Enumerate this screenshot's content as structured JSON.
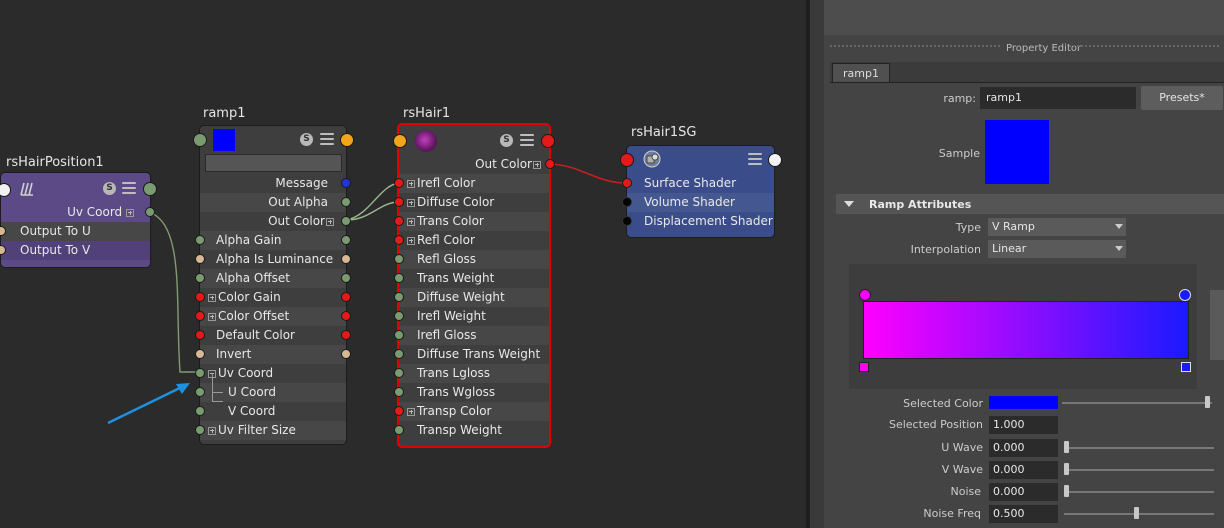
{
  "graph": {
    "rsHairPosition1": {
      "title": "rsHairPosition1",
      "rows": [
        "Uv Coord",
        "Output To U",
        "Output To V"
      ],
      "s_label": "S"
    },
    "ramp1": {
      "title": "ramp1",
      "s_label": "S",
      "swatch_color": "#0000ff",
      "rows": [
        "Message",
        "Out Alpha",
        "Out Color",
        "Alpha Gain",
        "Alpha Is Luminance",
        "Alpha Offset",
        "Color Gain",
        "Color Offset",
        "Default Color",
        "Invert",
        "Uv Coord",
        "U Coord",
        "V Coord",
        "Uv Filter Size"
      ]
    },
    "rsHair1": {
      "title": "rsHair1",
      "s_label": "S",
      "rows": [
        "Out Color",
        "Irefl Color",
        "Diffuse Color",
        "Trans Color",
        "Refl Color",
        "Refl Gloss",
        "Trans Weight",
        "Diffuse Weight",
        "Irefl Weight",
        "Irefl Gloss",
        "Diffuse Trans Weight",
        "Trans Lgloss",
        "Trans Wgloss",
        "Transp Color",
        "Transp Weight"
      ]
    },
    "rsHair1SG": {
      "title": "rsHair1SG",
      "rows": [
        "Surface Shader",
        "Volume Shader",
        "Displacement Shader"
      ]
    },
    "colors": {
      "selection_border": "#e00000",
      "annotation_arrow": "#1e90e0",
      "shading_group_bg": "#3a4d8a",
      "hair_position_bg": "#5b4a86"
    }
  },
  "property_editor": {
    "header": "Property Editor",
    "tab": "ramp1",
    "node_label": "ramp:",
    "node_value": "ramp1",
    "presets_label": "Presets*",
    "sample_label": "Sample",
    "sample_color": "#0000ff",
    "section_title": "Ramp Attributes",
    "type_label": "Type",
    "type_value": "V Ramp",
    "interp_label": "Interpolation",
    "interp_value": "Linear",
    "ramp_colors": {
      "start": "#ff00ff",
      "end": "#1a1aff"
    },
    "attrs": {
      "selected_color_label": "Selected Color",
      "selected_color": "#0000ff",
      "selected_position_label": "Selected Position",
      "selected_position": "1.000",
      "u_wave_label": "U Wave",
      "u_wave": "0.000",
      "v_wave_label": "V Wave",
      "v_wave": "0.000",
      "noise_label": "Noise",
      "noise": "0.000",
      "noise_freq_label": "Noise Freq",
      "noise_freq": "0.500"
    }
  }
}
